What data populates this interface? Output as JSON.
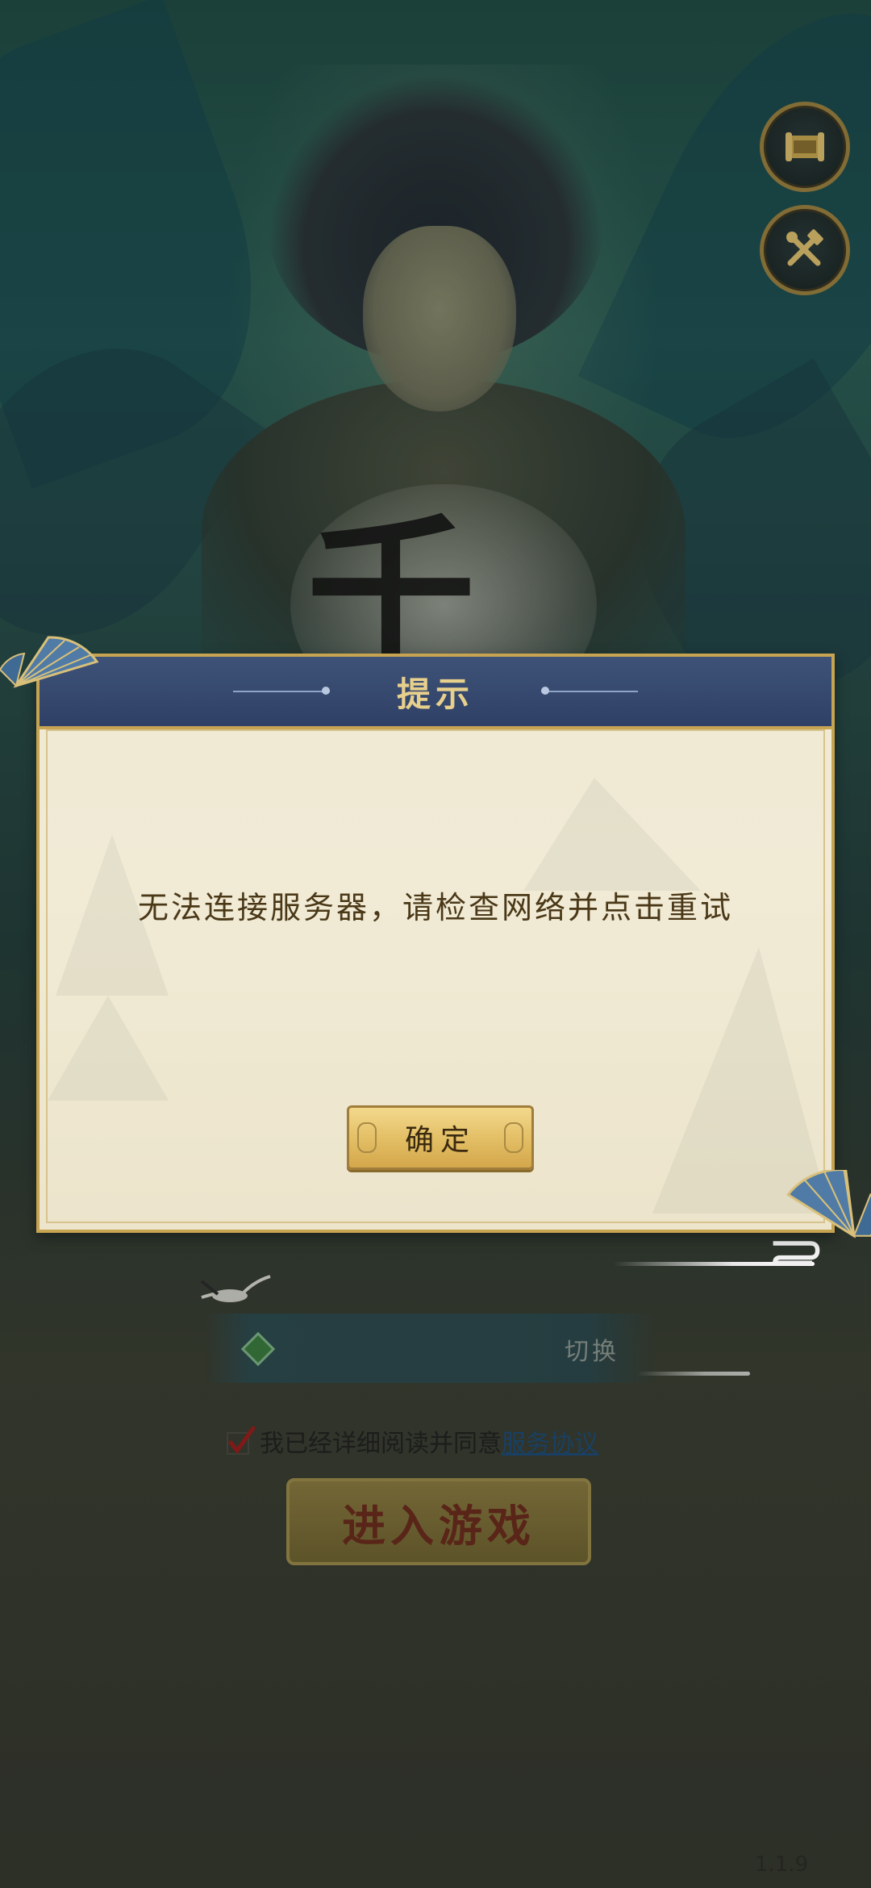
{
  "dialog": {
    "title": "提示",
    "message": "无法连接服务器，请检查网络并点击重试",
    "confirm_label": "确定"
  },
  "login": {
    "switch_label": "切换",
    "agreement_prefix": "我已经详细阅读并同意",
    "agreement_link": "服务协议",
    "enter_label": "进入游戏"
  },
  "version": "1.1.9",
  "background": {
    "logo_glyph": "千"
  },
  "side_buttons": [
    {
      "icon": "scroll-icon"
    },
    {
      "icon": "tools-icon"
    }
  ],
  "colors": {
    "dialog_header": "#34466d",
    "dialog_body": "#efe9d4",
    "dialog_border": "#c6a452",
    "confirm_button": "#e2bd63",
    "message_text": "#4a3817",
    "link": "#1d4b77"
  }
}
